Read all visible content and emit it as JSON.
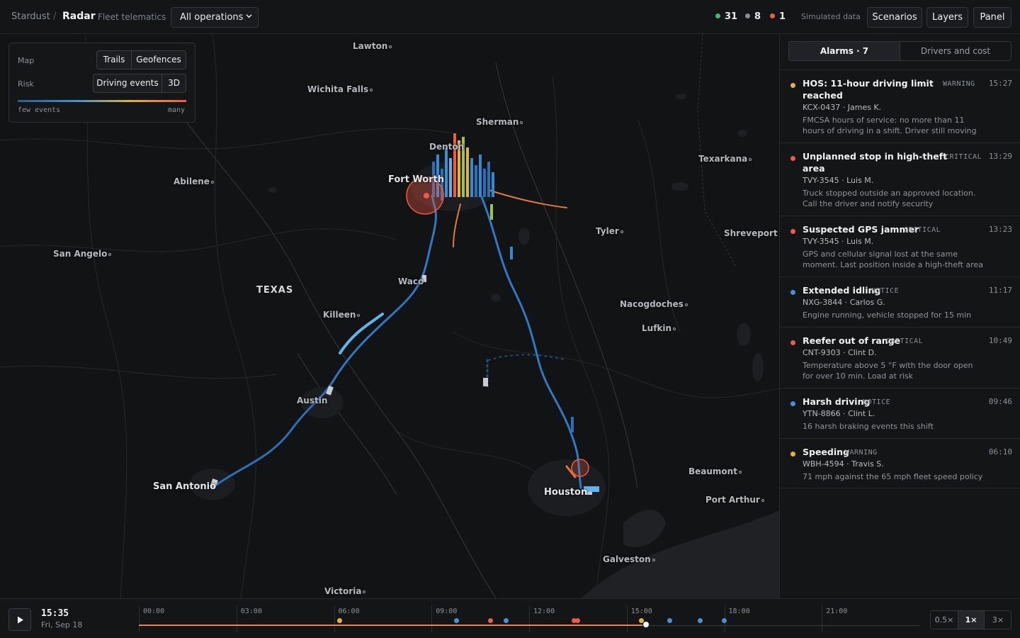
{
  "header": {
    "brand": "Stardust",
    "separator": "/",
    "page": "Radar",
    "subtitle": "Fleet telematics",
    "operations_select": "All operations",
    "counters": [
      {
        "value": "31",
        "color": "#3fbf6a"
      },
      {
        "value": "8",
        "color": "#8a8f96"
      },
      {
        "value": "1",
        "color": "#ef5b43"
      }
    ],
    "simulated": "Simulated data",
    "buttons": {
      "scenarios": "Scenarios",
      "layers": "Layers",
      "panel": "Panel"
    }
  },
  "legend": {
    "map_label": "Map",
    "map_options": [
      "Trails",
      "Geofences"
    ],
    "risk_label": "Risk",
    "risk_options": [
      "Driving events",
      "3D"
    ],
    "scale_low": "few events",
    "scale_high": "many"
  },
  "map": {
    "state": "TEXAS",
    "cities": [
      {
        "name": "Lawton"
      },
      {
        "name": "Wichita Falls"
      },
      {
        "name": "Sherman"
      },
      {
        "name": "Denton"
      },
      {
        "name": "Texarkana"
      },
      {
        "name": "Fort Worth"
      },
      {
        "name": "Abilene"
      },
      {
        "name": "Tyler"
      },
      {
        "name": "Shreveport"
      },
      {
        "name": "San Angelo"
      },
      {
        "name": "Waco"
      },
      {
        "name": "Killeen"
      },
      {
        "name": "Nacogdoches"
      },
      {
        "name": "Lufkin"
      },
      {
        "name": "Austin"
      },
      {
        "name": "San Antonio"
      },
      {
        "name": "Houston"
      },
      {
        "name": "Beaumont"
      },
      {
        "name": "Port Arthur"
      },
      {
        "name": "Galveston"
      },
      {
        "name": "Victoria"
      }
    ]
  },
  "panel": {
    "tabs": [
      "Alarms · 7",
      "Drivers and cost"
    ],
    "alarms": [
      {
        "title_l1": "HOS: 11-hour driving limit",
        "title_l2": "reached",
        "severity": "WARNING",
        "time": "15:27",
        "vehicle": "KCX-0437 · James K.",
        "desc_l1": "FMCSA hours of service: no more than 11",
        "desc_l2": "hours of driving in a shift. Driver still moving",
        "color": "#e3b341"
      },
      {
        "title_l1": "Unplanned stop in high-theft",
        "title_l2": "area",
        "severity": "CRITICAL",
        "time": "13:29",
        "vehicle": "TVY-3545 · Luis M.",
        "desc_l1": "Truck stopped outside an approved location.",
        "desc_l2": "Call the driver and notify security",
        "color": "#ef5b43"
      },
      {
        "title_l1": "Suspected GPS jammer",
        "title_l2": "",
        "severity": "CRITICAL",
        "time": "13:23",
        "vehicle": "TVY-3545 · Luis M.",
        "desc_l1": "GPS and cellular signal lost at the same",
        "desc_l2": "moment. Last position inside a high-theft area",
        "color": "#ef5b43"
      },
      {
        "title_l1": "Extended idling",
        "title_l2": "",
        "severity": "NOTICE",
        "time": "11:17",
        "vehicle": "NXG-3844 · Carlos G.",
        "desc_l1": "Engine running, vehicle stopped for 15 min",
        "desc_l2": "",
        "color": "#4a90d9"
      },
      {
        "title_l1": "Reefer out of range",
        "title_l2": "",
        "severity": "CRITICAL",
        "time": "10:49",
        "vehicle": "CNT-9303 · Clint D.",
        "desc_l1": "Temperature above 5 °F with the door open",
        "desc_l2": "for over 10 min. Load at risk",
        "color": "#ef5b43"
      },
      {
        "title_l1": "Harsh driving",
        "title_l2": "",
        "severity": "NOTICE",
        "time": "09:46",
        "vehicle": "YTN-8866 · Clint L.",
        "desc_l1": "16 harsh braking events this shift",
        "desc_l2": "",
        "color": "#4a90d9"
      },
      {
        "title_l1": "Speeding",
        "title_l2": "",
        "severity": "WARNING",
        "time": "06:10",
        "vehicle": "WBH-4594 · Travis S.",
        "desc_l1": "71 mph against the 65 mph fleet speed policy",
        "desc_l2": "",
        "color": "#e3b341"
      }
    ]
  },
  "timeline": {
    "play": "play-icon",
    "clock": "15:35",
    "date": "Fri, Sep 18",
    "ticks": [
      "00:00",
      "03:00",
      "06:00",
      "09:00",
      "12:00",
      "15:00",
      "18:00",
      "21:00"
    ],
    "progress_fraction": 0.6493,
    "events": [
      {
        "t": "06:10",
        "color": "#e3b341"
      },
      {
        "t": "09:46",
        "color": "#4a90d9"
      },
      {
        "t": "10:49",
        "color": "#ef5b43"
      },
      {
        "t": "11:17",
        "color": "#4a90d9"
      },
      {
        "t": "13:23",
        "color": "#ef5b43"
      },
      {
        "t": "13:29",
        "color": "#ef5b43"
      },
      {
        "t": "15:27",
        "color": "#e3b341"
      },
      {
        "t": "16:20",
        "color": "#4a90d9"
      },
      {
        "t": "17:15",
        "color": "#4a90d9"
      },
      {
        "t": "18:00",
        "color": "#4a90d9"
      }
    ],
    "speeds": [
      "0.5×",
      "1×",
      "3×"
    ],
    "active_speed": "1×"
  }
}
